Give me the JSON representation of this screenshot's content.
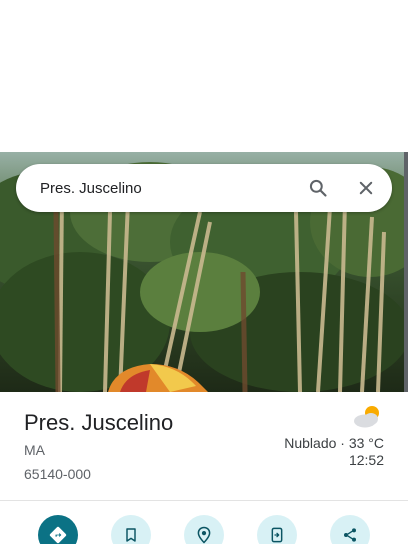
{
  "search": {
    "query": "Pres. Juscelino"
  },
  "place": {
    "title": "Pres. Juscelino",
    "state": "MA",
    "postal_code": "65140-000"
  },
  "weather": {
    "icon": "partly-cloudy-icon",
    "condition_temp": "Nublado · 33 °C",
    "time": "12:52"
  },
  "actions": [
    {
      "icon": "directions-icon"
    },
    {
      "icon": "bookmark-icon"
    },
    {
      "icon": "nearby-icon"
    },
    {
      "icon": "send-to-phone-icon"
    },
    {
      "icon": "share-icon"
    }
  ],
  "colors": {
    "accent": "#0b7285",
    "action_bg": "#d8f1f5"
  }
}
